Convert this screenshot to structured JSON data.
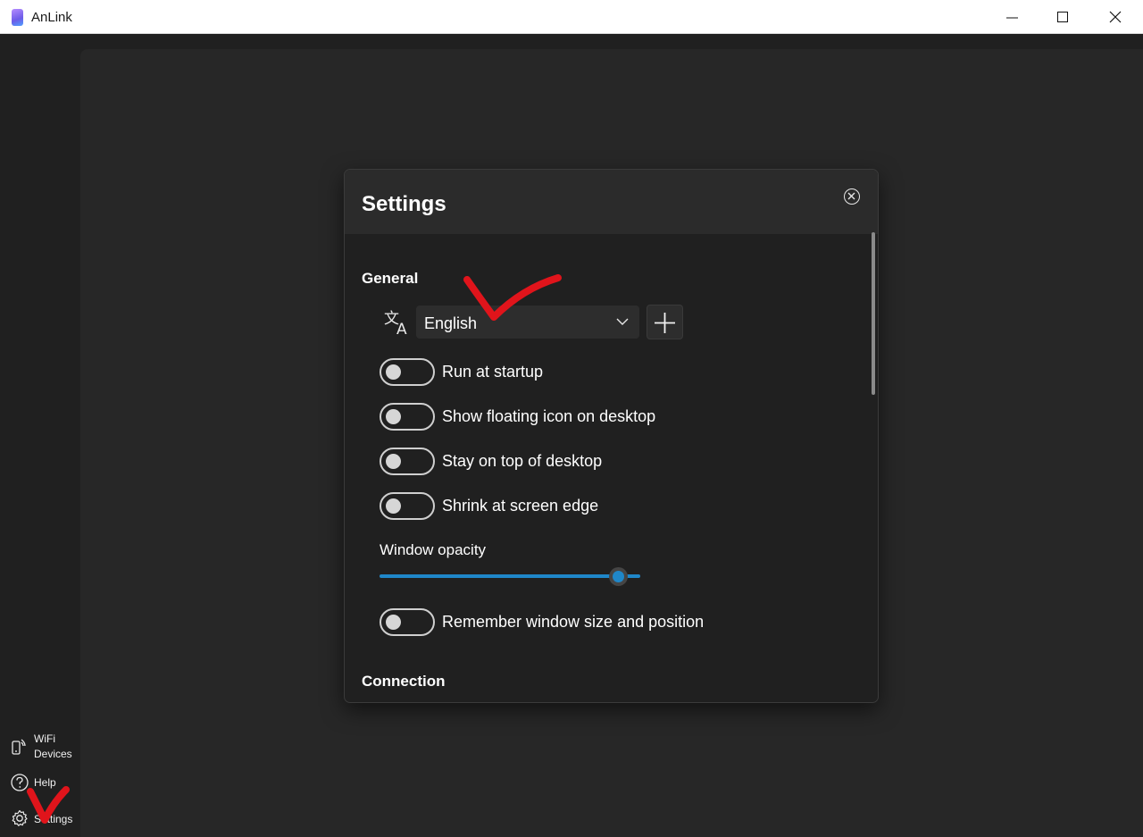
{
  "window": {
    "title": "AnLink",
    "controls": [
      "minimize-icon",
      "maximize-icon",
      "close-icon"
    ]
  },
  "sidebar": {
    "items": [
      {
        "label": "WiFi\nDevices",
        "icon": "phone-wifi-icon"
      },
      {
        "label": "Help",
        "icon": "help-icon"
      },
      {
        "label": "Settings",
        "icon": "gear-icon"
      }
    ]
  },
  "settings": {
    "title": "Settings",
    "general": {
      "heading": "General",
      "language": {
        "selected": "English",
        "icon": "translate-icon"
      },
      "toggles": [
        {
          "label": "Run at startup",
          "on": false
        },
        {
          "label": "Show floating icon on desktop",
          "on": false
        },
        {
          "label": "Stay on top of desktop",
          "on": false
        },
        {
          "label": "Shrink at screen edge",
          "on": false
        }
      ],
      "opacity": {
        "label": "Window opacity",
        "level": 0.95
      },
      "remember": {
        "label": "Remember window size and position",
        "on": false
      }
    },
    "connection": {
      "heading": "Connection"
    }
  },
  "colors": {
    "accent": "#1f87c9",
    "annotation": "#e0141b",
    "background": "#202020"
  }
}
